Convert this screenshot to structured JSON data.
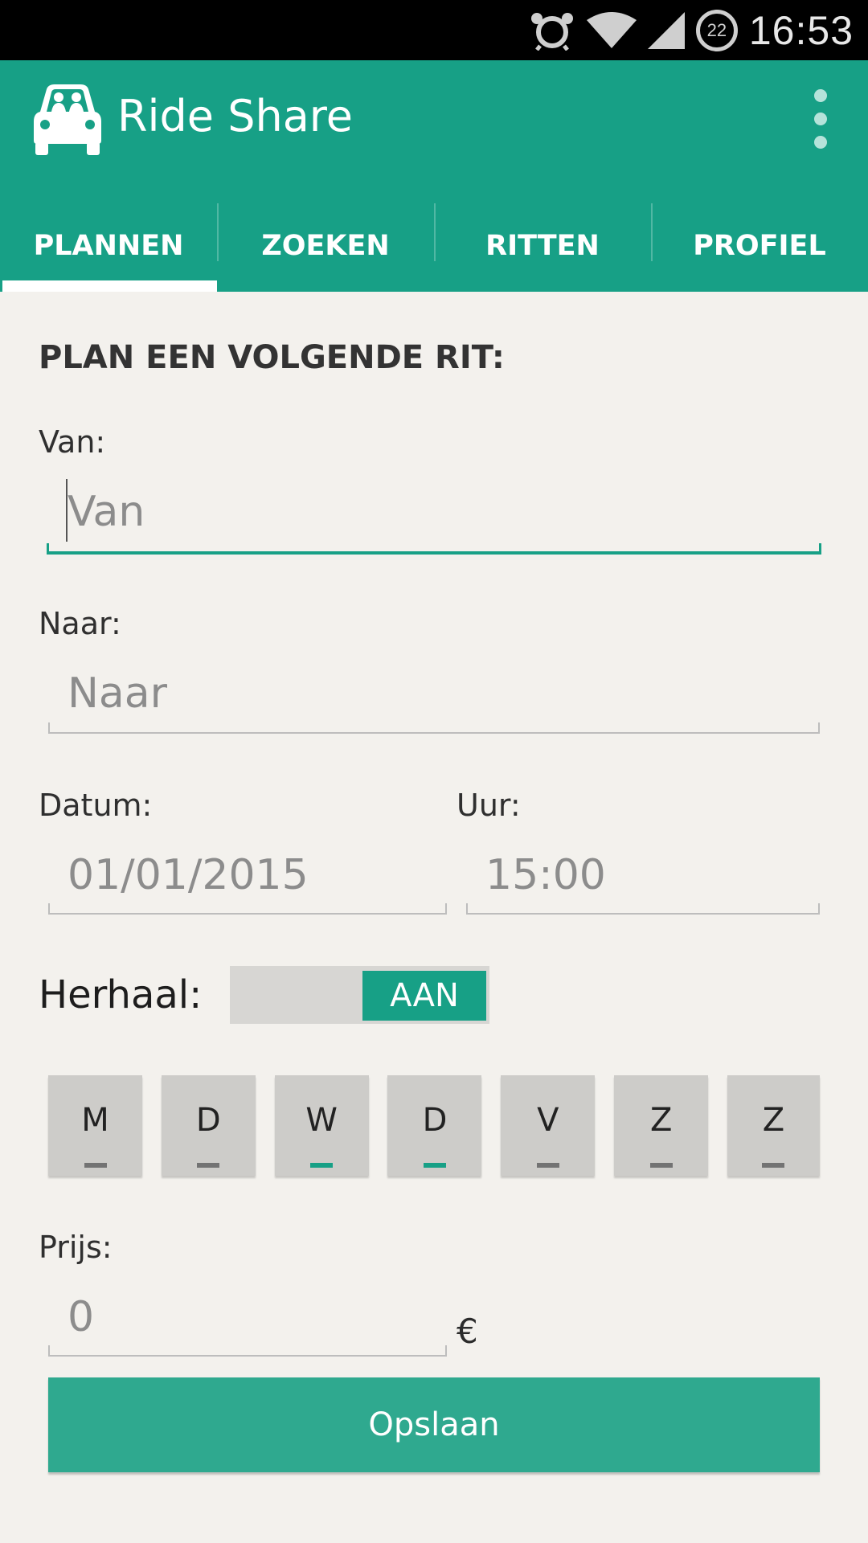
{
  "status_bar": {
    "time": "16:53",
    "battery": "22"
  },
  "app": {
    "title": "Ride Share"
  },
  "tabs": [
    {
      "label": "PLANNEN",
      "active": true
    },
    {
      "label": "ZOEKEN",
      "active": false
    },
    {
      "label": "RITTEN",
      "active": false
    },
    {
      "label": "PROFIEL",
      "active": false
    }
  ],
  "form": {
    "title": "PLAN EEN VOLGENDE RIT:",
    "van": {
      "label": "Van:",
      "placeholder": "Van"
    },
    "naar": {
      "label": "Naar:",
      "placeholder": "Naar"
    },
    "datum": {
      "label": "Datum:",
      "placeholder": "01/01/2015"
    },
    "uur": {
      "label": "Uur:",
      "placeholder": "15:00"
    },
    "herhaal": {
      "label": "Herhaal:",
      "toggle_text": "AAN",
      "state": "on"
    },
    "days": [
      {
        "letter": "M",
        "selected": false
      },
      {
        "letter": "D",
        "selected": false
      },
      {
        "letter": "W",
        "selected": true
      },
      {
        "letter": "D",
        "selected": true
      },
      {
        "letter": "V",
        "selected": false
      },
      {
        "letter": "Z",
        "selected": false
      },
      {
        "letter": "Z",
        "selected": false
      }
    ],
    "prijs": {
      "label": "Prijs:",
      "placeholder": "0",
      "currency": "€"
    },
    "save_label": "Opslaan"
  },
  "colors": {
    "primary": "#17a086",
    "button": "#2fa98f",
    "background": "#f3f1ed"
  }
}
